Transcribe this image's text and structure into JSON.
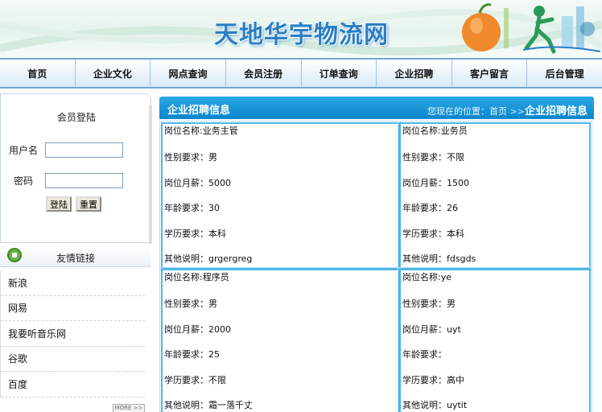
{
  "header": {
    "site_title": "天地华宇物流网"
  },
  "nav": [
    "首页",
    "企业文化",
    "网点查询",
    "会员注册",
    "订单查询",
    "企业招聘",
    "客户留言",
    "后台管理"
  ],
  "login": {
    "title": "会员登陆",
    "username_label": "用户名",
    "password_label": "密码",
    "login_button": "登陆",
    "reset_button": "重置"
  },
  "links": {
    "title": "友情链接",
    "items": [
      "新浪",
      "网易",
      "我要听音乐网",
      "谷歌",
      "百度"
    ],
    "more": "MORE >>"
  },
  "main": {
    "title": "企业招聘信息",
    "crumb_prefix": "您现在的位置：首页",
    "crumb_sep": ">>",
    "crumb_current": "企业招聘信息"
  },
  "jobs": [
    {
      "name": "岗位名称:业务主管",
      "gender": "性别要求：男",
      "salary": "岗位月薪：5000",
      "age": "年龄要求：30",
      "edu": "学历要求：本科",
      "note": "其他说明：grgergreg"
    },
    {
      "name": "岗位名称:业务员",
      "gender": "性别要求：不限",
      "salary": "岗位月薪：1500",
      "age": "年龄要求：26",
      "edu": "学历要求：本科",
      "note": "其他说明：fdsgds"
    },
    {
      "name": "岗位名称:程序员",
      "gender": "性别要求：男",
      "salary": "岗位月薪：2000",
      "age": "年龄要求：25",
      "edu": "学历要求：不限",
      "note": "其他说明：霜一落千丈"
    },
    {
      "name": "岗位名称:ye",
      "gender": "性别要求：男",
      "salary": "岗位月薪：uyt",
      "age": "年龄要求：",
      "edu": "学历要求：高中",
      "note": "其他说明：uytit"
    }
  ],
  "colors": {
    "accent": "#0b86cc",
    "nav_border": "#6fa9d8",
    "card_border": "#4fb6e8"
  }
}
